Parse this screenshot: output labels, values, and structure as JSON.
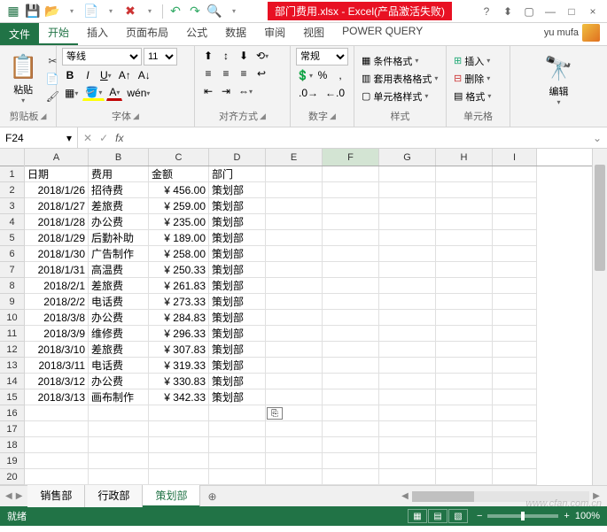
{
  "qat": {
    "icons": [
      "excel-icon",
      "save-icon",
      "open-icon",
      "down-icon",
      "new-icon",
      "down-icon",
      "close-icon",
      "down-icon",
      "undo-icon",
      "redo-icon",
      "preview-icon",
      "down-icon"
    ],
    "title_file": "部门费用.xlsx - Excel(产品激活失败)",
    "win": [
      "?",
      "⤢",
      "▭",
      "—",
      "□",
      "×"
    ]
  },
  "tabs": {
    "file": "文件",
    "items": [
      "开始",
      "插入",
      "页面布局",
      "公式",
      "数据",
      "审阅",
      "视图",
      "POWER QUERY"
    ],
    "active": 0,
    "user": "yu mufa"
  },
  "ribbon": {
    "clipboard": {
      "label": "剪贴板",
      "paste": "粘贴"
    },
    "font": {
      "label": "字体",
      "name": "等线",
      "size": "11"
    },
    "align": {
      "label": "对齐方式"
    },
    "number": {
      "label": "数字",
      "format": "常规"
    },
    "styles": {
      "label": "样式",
      "cond": "条件格式",
      "table": "套用表格格式",
      "cell": "单元格样式"
    },
    "cells": {
      "label": "单元格",
      "insert": "插入",
      "delete": "删除",
      "format": "格式"
    },
    "editing": {
      "label": "编辑"
    }
  },
  "namebox": {
    "ref": "F24",
    "formula": ""
  },
  "cols": [
    "A",
    "B",
    "C",
    "D",
    "E",
    "F",
    "G",
    "H",
    "I"
  ],
  "header_row": [
    "日期",
    "费用",
    "金额",
    "",
    "部门"
  ],
  "data_rows": [
    [
      "2018/1/26",
      "招待费",
      "¥",
      "456.00",
      "策划部"
    ],
    [
      "2018/1/27",
      "差旅费",
      "¥",
      "259.00",
      "策划部"
    ],
    [
      "2018/1/28",
      "办公费",
      "¥",
      "235.00",
      "策划部"
    ],
    [
      "2018/1/29",
      "后勤补助",
      "¥",
      "189.00",
      "策划部"
    ],
    [
      "2018/1/30",
      "广告制作",
      "¥",
      "258.00",
      "策划部"
    ],
    [
      "2018/1/31",
      "高温费",
      "¥",
      "250.33",
      "策划部"
    ],
    [
      "2018/2/1",
      "差旅费",
      "¥",
      "261.83",
      "策划部"
    ],
    [
      "2018/2/2",
      "电话费",
      "¥",
      "273.33",
      "策划部"
    ],
    [
      "2018/3/8",
      "办公费",
      "¥",
      "284.83",
      "策划部"
    ],
    [
      "2018/3/9",
      "维修费",
      "¥",
      "296.33",
      "策划部"
    ],
    [
      "2018/3/10",
      "差旅费",
      "¥",
      "307.83",
      "策划部"
    ],
    [
      "2018/3/11",
      "电话费",
      "¥",
      "319.33",
      "策划部"
    ],
    [
      "2018/3/12",
      "办公费",
      "¥",
      "330.83",
      "策划部"
    ],
    [
      "2018/3/13",
      "画布制作",
      "¥",
      "342.33",
      "策划部"
    ]
  ],
  "empty_rows": 5,
  "sheets": {
    "items": [
      "销售部",
      "行政部",
      "策划部"
    ],
    "active": 2
  },
  "status": {
    "ready": "就绪",
    "zoom": "100%"
  },
  "watermark": "www.cfan.com.cn"
}
